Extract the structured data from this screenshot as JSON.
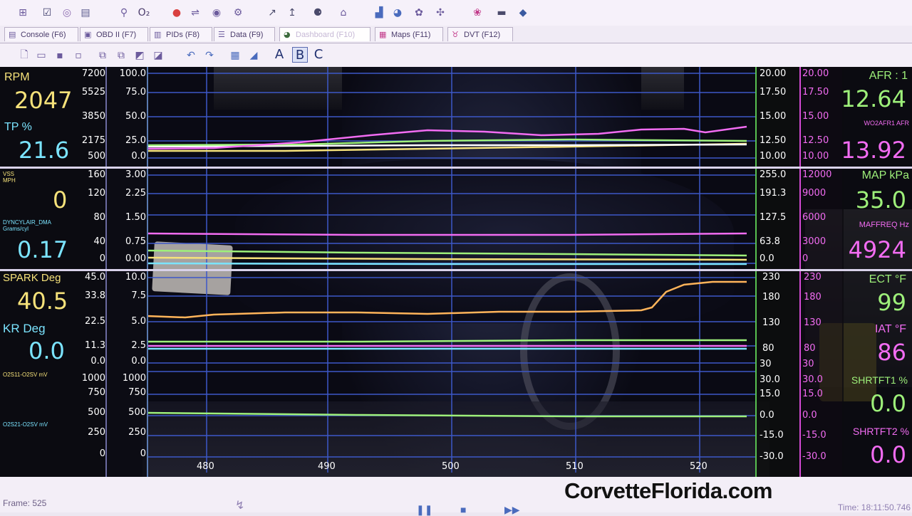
{
  "toolbar": {
    "icons": [
      "table-icon",
      "checkbox-icon",
      "gauge-icon",
      "clipboard-icon",
      "wand-icon",
      "o2-icon",
      "record-icon",
      "connect-icon",
      "vehicle-icon",
      "settings-icon",
      "edit-icon",
      "edit2-icon",
      "engine-icon",
      "chair-icon",
      "chart-icon",
      "db-icon",
      "tools-icon",
      "tools2-icon",
      "paw-icon",
      "wrench-icon",
      "fuel-icon"
    ],
    "o2_label": "O₂"
  },
  "tabs": [
    {
      "label": "Console (F6)",
      "icon": "console-icon",
      "active": false
    },
    {
      "label": "OBD II (F7)",
      "icon": "obd-icon",
      "active": false
    },
    {
      "label": "PIDs (F8)",
      "icon": "pids-icon",
      "active": false
    },
    {
      "label": "Data (F9)",
      "icon": "data-icon",
      "active": false
    },
    {
      "label": "Dashboard (F10)",
      "icon": "dashboard-icon",
      "active": true
    },
    {
      "label": "Maps (F11)",
      "icon": "maps-icon",
      "active": false
    },
    {
      "label": "DVT (F12)",
      "icon": "dvt-icon",
      "active": false
    }
  ],
  "toolbar2": {
    "letters": [
      "A",
      "B",
      "C"
    ]
  },
  "colors": {
    "yellow": "#f6e27a",
    "cyan": "#7be4ff",
    "green": "#9ef07a",
    "magenta": "#f26cf2",
    "white": "#ffffff",
    "orange": "#ffb45a",
    "grid": "#3d58c8"
  },
  "left_panel": {
    "rpm_label": "RPM",
    "rpm_value": "2047",
    "tp_label": "TP %",
    "tp_value": "21.6",
    "vss_label": "VSS\nMPH",
    "vss_value": "0",
    "dyncyl_label": "DYNCYLAIR_DMA\nGrams/cyl",
    "dyncyl_value": "0.17",
    "spark_label": "SPARK Deg",
    "spark_value": "40.5",
    "kr_label": "KR Deg",
    "kr_value": "0.0",
    "o2s11_label": "O2S11-O2SV mV",
    "o2s21_label": "O2S21-O2SV mV"
  },
  "right_panel": {
    "afr_label": "AFR : 1",
    "afr_value": "12.64",
    "wo2_label": "WO2AFR1 AFR",
    "wo2_value": "13.92",
    "map_label": "MAP kPa",
    "map_value": "35.0",
    "maf_label": "MAFFREQ Hz",
    "maf_value": "4924",
    "ect_label": "ECT °F",
    "ect_value": "99",
    "iat_label": "IAT °F",
    "iat_value": "86",
    "shrtft1_label": "SHRTFT1 %",
    "shrtft1_value": "0.0",
    "shrtft2_label": "SHRTFT2 %",
    "shrtft2_value": "0.0"
  },
  "scales": {
    "p1_left_outer": [
      "7200",
      "5525",
      "3850",
      "2175",
      "500"
    ],
    "p1_left_inner": [
      "100.0",
      "75.0",
      "50.0",
      "25.0",
      "0.0"
    ],
    "p1_right_green": [
      "20.00",
      "17.50",
      "15.00",
      "12.50",
      "10.00"
    ],
    "p1_right_magenta": [
      "20.00",
      "17.50",
      "15.00",
      "12.50",
      "10.00"
    ],
    "p2_left_outer": [
      "160",
      "120",
      "80",
      "40",
      "0"
    ],
    "p2_left_inner": [
      "3.00",
      "2.25",
      "1.50",
      "0.75",
      "0.00"
    ],
    "p2_right_green": [
      "255.0",
      "191.3",
      "127.5",
      "63.8",
      "0.0"
    ],
    "p2_right_magenta": [
      "12000",
      "9000",
      "6000",
      "3000",
      "0"
    ],
    "p3_left_outer": [
      "45.0",
      "33.8",
      "22.5",
      "11.3",
      "0.0"
    ],
    "p3_left_inner": [
      "10.0",
      "7.5",
      "5.0",
      "2.5",
      "0.0"
    ],
    "p3_right_green": [
      "230",
      "180",
      "130",
      "80"
    ],
    "p3_right_magenta": [
      "230",
      "180",
      "130",
      "80"
    ],
    "p4_left_outer": [
      "1000",
      "750",
      "500",
      "250",
      "0"
    ],
    "p4_left_inner": [
      "1000",
      "750",
      "500",
      "250",
      "0"
    ],
    "p4_right_green": [
      "30",
      "30.0",
      "15.0",
      "0.0",
      "-15.0",
      "-30.0"
    ],
    "p4_right_magenta": [
      "30",
      "30.0",
      "15.0",
      "0.0",
      "-15.0",
      "-30.0"
    ],
    "x_ticks": [
      "480",
      "490",
      "500",
      "510",
      "520"
    ]
  },
  "status": {
    "frame": "Frame: 525",
    "time": "Time: 18:11:50.746",
    "watermark": "CorvetteFlorida.com"
  }
}
